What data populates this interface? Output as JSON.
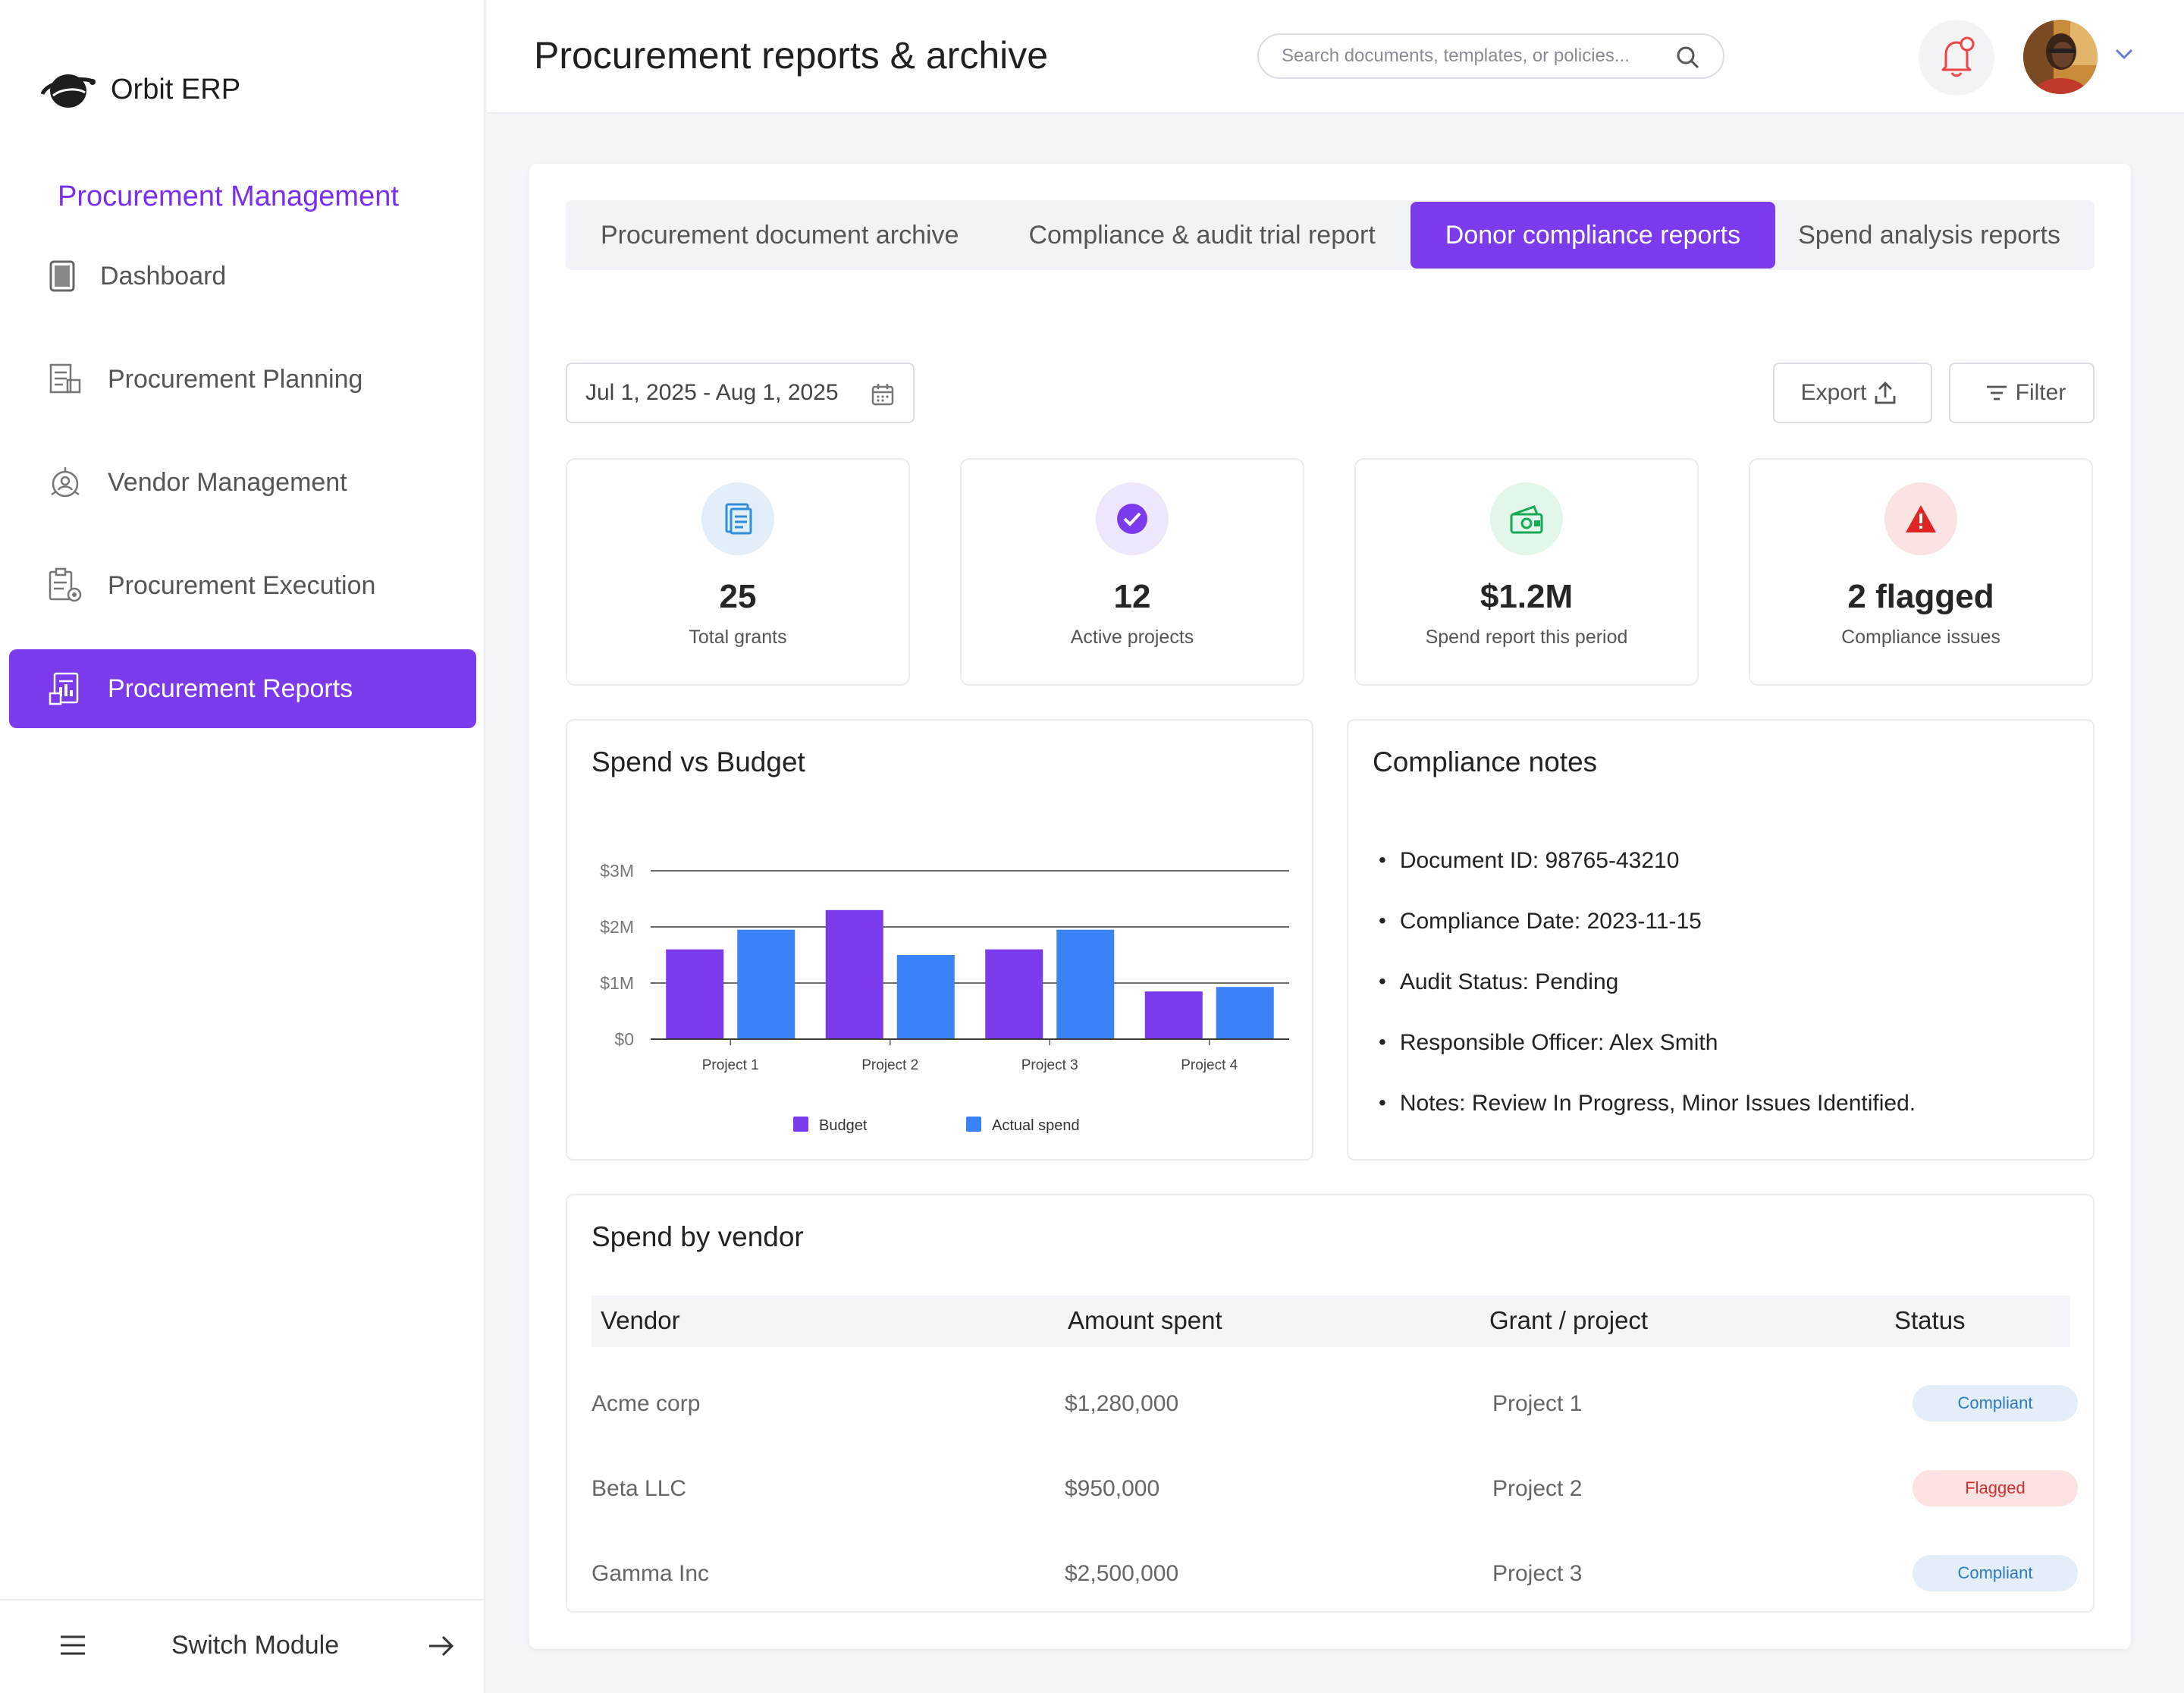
{
  "app": {
    "brand": "Orbit ERP"
  },
  "sidebar": {
    "section_title": "Procurement Management",
    "items": [
      {
        "label": "Dashboard",
        "icon": "tablet-icon"
      },
      {
        "label": "Procurement Planning",
        "icon": "planning-icon"
      },
      {
        "label": "Vendor Management",
        "icon": "vendor-icon"
      },
      {
        "label": "Procurement Execution",
        "icon": "execution-icon"
      },
      {
        "label": "Procurement Reports",
        "icon": "report-icon",
        "active": true
      }
    ],
    "switch_label": "Switch Module"
  },
  "header": {
    "title": "Procurement reports & archive",
    "search_placeholder": "Search documents, templates, or policies..."
  },
  "tabs": [
    {
      "label": "Procurement document archive"
    },
    {
      "label": "Compliance & audit trial report"
    },
    {
      "label": "Donor compliance reports",
      "active": true
    },
    {
      "label": "Spend analysis reports"
    }
  ],
  "toolbar": {
    "date_range": "Jul 1, 2025 - Aug 1, 2025",
    "export_label": "Export",
    "filter_label": "Filter"
  },
  "stats": [
    {
      "value": "25",
      "label": "Total grants",
      "icon": "document-icon",
      "color": "#2f8fd8"
    },
    {
      "value": "12",
      "label": "Active projects",
      "icon": "check-icon",
      "color": "#7c3aed"
    },
    {
      "value": "$1.2M",
      "label": "Spend report this period",
      "icon": "money-icon",
      "color": "#18a957"
    },
    {
      "value": "2 flagged",
      "label": "Compliance issues",
      "icon": "warning-icon",
      "color": "#e02424"
    }
  ],
  "chart_panel": {
    "title": "Spend vs Budget"
  },
  "chart_data": {
    "type": "bar",
    "categories": [
      "Project 1",
      "Project 2",
      "Project 3",
      "Project 4"
    ],
    "series": [
      {
        "name": "Budget",
        "values": [
          1.6,
          2.3,
          1.6,
          0.85
        ],
        "color": "#7c3aed"
      },
      {
        "name": "Actual spend",
        "values": [
          1.95,
          1.5,
          1.95,
          0.93
        ],
        "color": "#3b82f6"
      }
    ],
    "y_ticks": [
      "$0",
      "$1M",
      "$2M",
      "$3M"
    ],
    "ylim": [
      0,
      3
    ],
    "grid": true,
    "legend": "bottom"
  },
  "notes_panel": {
    "title": "Compliance notes",
    "items": [
      "Document ID: 98765-43210",
      "Compliance Date: 2023-11-15",
      "Audit Status: Pending",
      "Responsible Officer: Alex Smith",
      "Notes: Review In Progress, Minor Issues Identified."
    ]
  },
  "vendor_panel": {
    "title": "Spend by vendor",
    "columns": [
      "Vendor",
      "Amount spent",
      "Grant / project",
      "Status"
    ],
    "rows": [
      {
        "vendor": "Acme corp",
        "amount": "$1,280,000",
        "project": "Project 1",
        "status": "Compliant"
      },
      {
        "vendor": "Beta LLC",
        "amount": "$950,000",
        "project": "Project 2",
        "status": "Flagged"
      },
      {
        "vendor": "Gamma Inc",
        "amount": "$2,500,000",
        "project": "Project 3",
        "status": "Compliant"
      }
    ]
  },
  "colors": {
    "accent": "#7c3aed",
    "compliant_bg": "#e3eef8",
    "compliant_text": "#2b7bbf",
    "flagged_bg": "#fde2e2",
    "flagged_text": "#d32f2f"
  }
}
